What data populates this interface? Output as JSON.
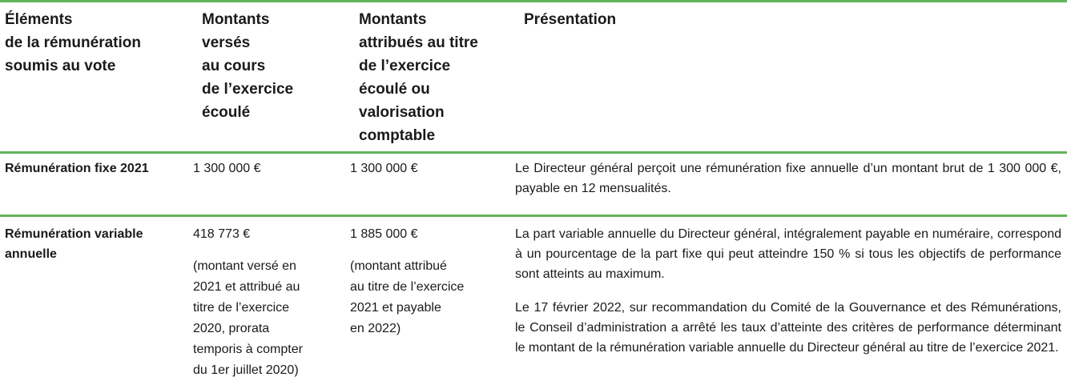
{
  "headers": {
    "col1": "Éléments\nde la rémunération\nsoumis au vote",
    "col2": "Montants\nversés\nau cours\nde l’exercice\nécoulé",
    "col3": "Montants\nattribués au titre\nde l’exercice\nécoulé ou\nvalorisation\ncomptable",
    "col4": "Présentation"
  },
  "rows": [
    {
      "element": "Rémunération fixe 2021",
      "paid": "1 300 000 €",
      "awarded": "1 300 000 €",
      "presentation": [
        "Le Directeur général perçoit une rémunération fixe annuelle d’un montant brut de 1 300 000 €, payable en 12 mensualités."
      ]
    },
    {
      "element": "Rémunération variable annuelle",
      "paid": "418 773 €",
      "paid_note": "(montant versé en\n2021 et attribué au\ntitre de l’exercice\n2020, prorata\ntemporis à compter\ndu 1er juillet 2020)",
      "awarded": "1 885 000 €",
      "awarded_note": "(montant attribué\nau titre de l’exercice\n2021 et payable\nen 2022)",
      "presentation": [
        "La part variable annuelle du Directeur général, intégralement payable en numéraire, correspond à un pourcentage de la part fixe qui peut atteindre 150 % si tous les objectifs de performance sont atteints au maximum.",
        "Le 17 février 2022, sur recommandation du Comité de la Gouvernance et des Rémunérations, le Conseil d’administration a arrêté les taux d’atteinte des critères de performance déterminant le montant de la rémunération variable annuelle du Directeur général au titre de l’exercice 2021."
      ]
    }
  ]
}
